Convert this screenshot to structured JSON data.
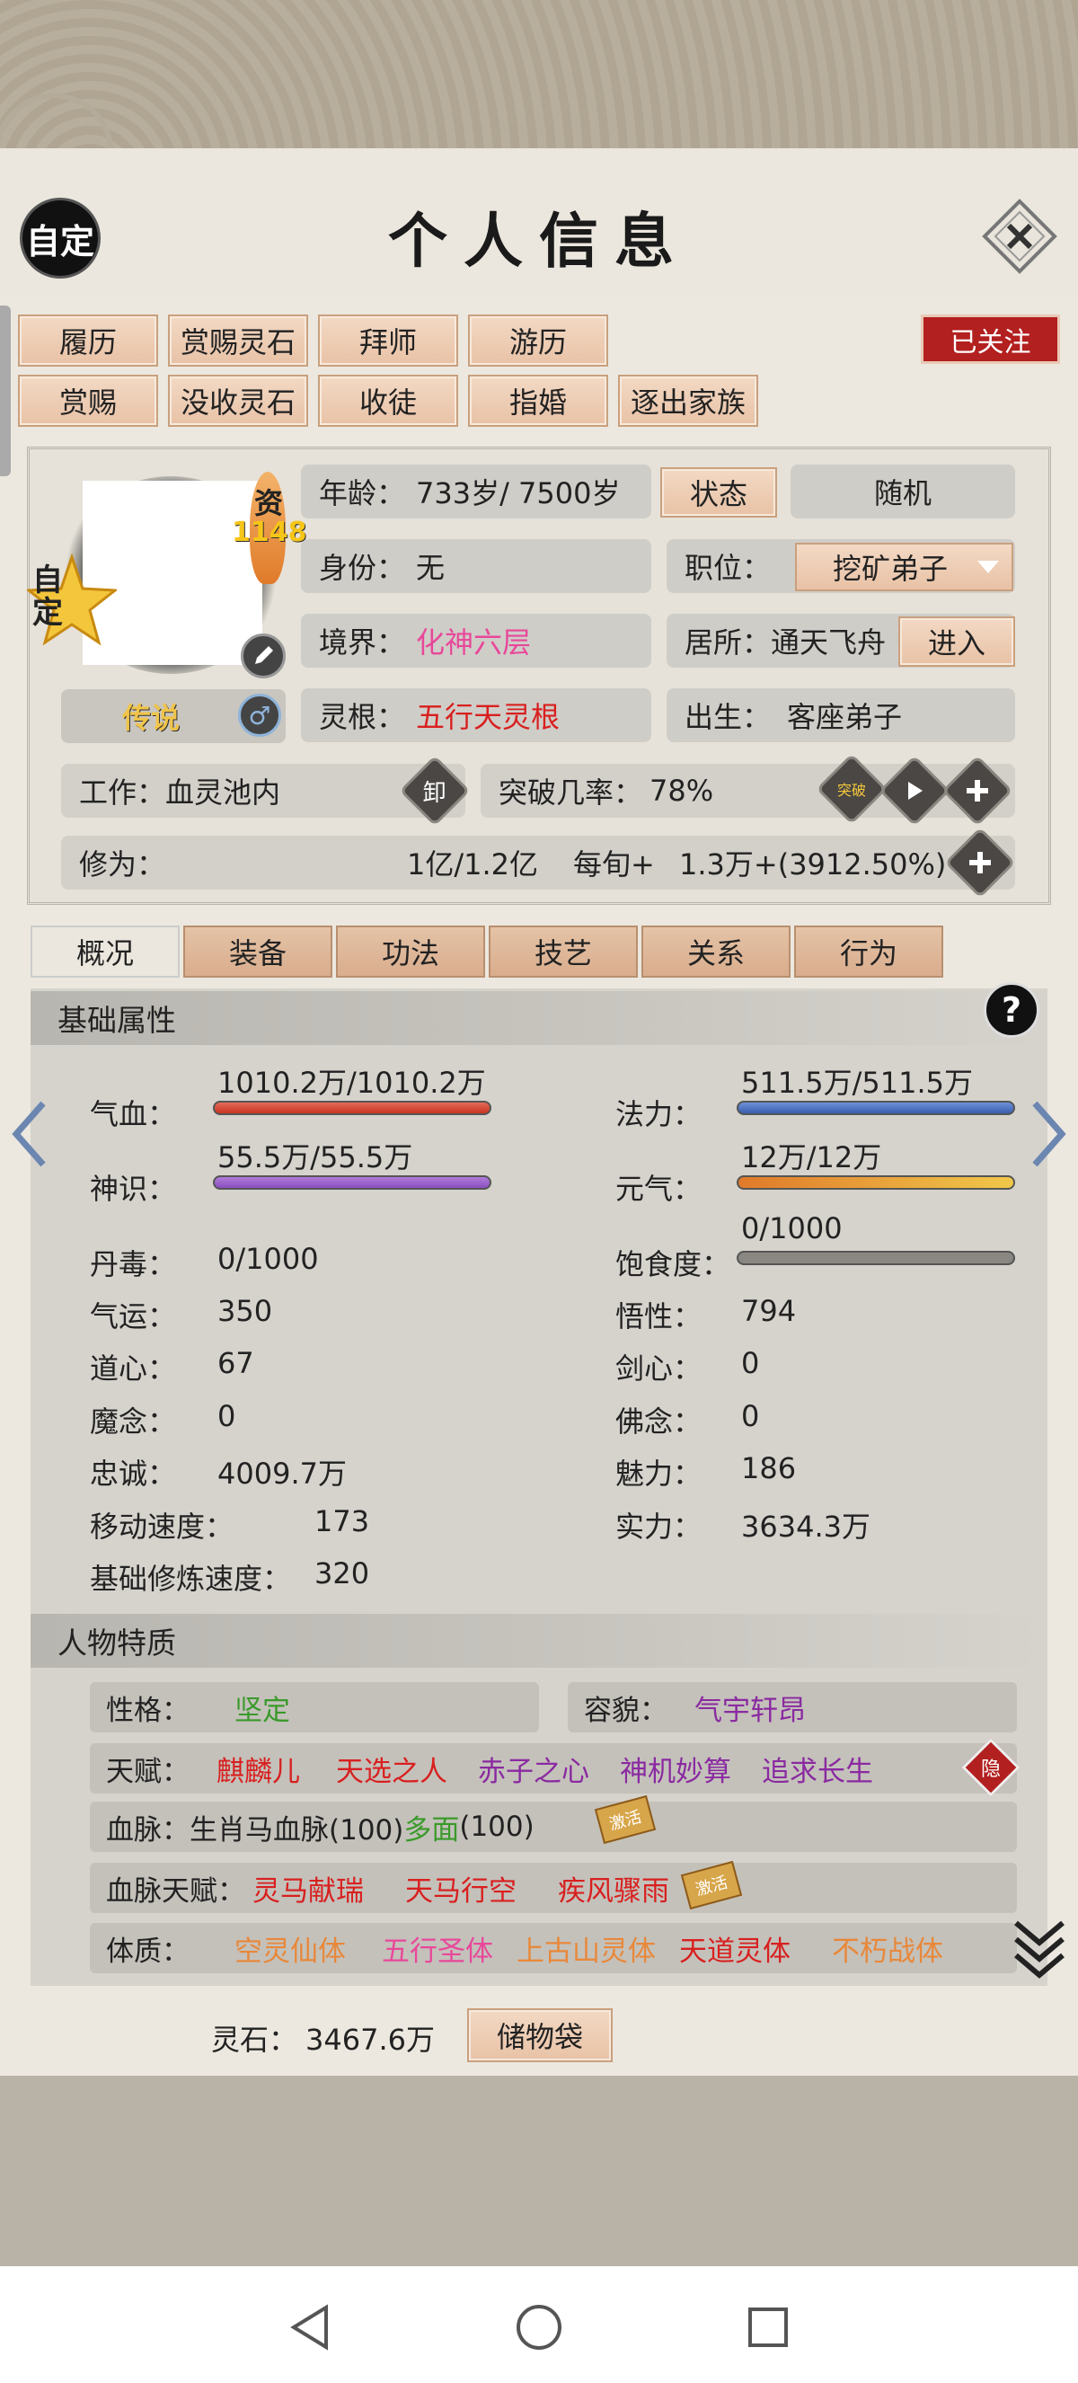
{
  "header": {
    "title": "个人信息",
    "custom_label": "自定"
  },
  "top_buttons_row1": [
    "履历",
    "赏赐灵石",
    "拜师",
    "游历"
  ],
  "top_buttons_row2": [
    "赏赐",
    "没收灵石",
    "收徒",
    "指婚",
    "逐出家族"
  ],
  "followed_label": "已关注",
  "avatar": {
    "zi_label": "资",
    "zi_value": "1148",
    "custom_badge": "自定",
    "rank": "传说"
  },
  "info": {
    "age_label": "年龄：",
    "age_value": "733岁/ 7500岁",
    "status_btn": "状态",
    "random_btn": "随机",
    "identity_label": "身份：",
    "identity_value": "无",
    "position_label": "职位：",
    "position_value": "挖矿弟子",
    "realm_label": "境界：",
    "realm_value": "化神六层",
    "residence_label": "居所：",
    "residence_value": "通天飞舟",
    "enter_btn": "进入",
    "root_label": "灵根：",
    "root_value": "五行天灵根",
    "birth_label": "出生：",
    "birth_value": "客座弟子",
    "work_label": "工作：",
    "work_value": "血灵池内",
    "unload_icon": "卸",
    "breakthrough_label": "突破几率：",
    "breakthrough_value": "78%",
    "breakthrough_icon": "突破",
    "cultivation_label": "修为：",
    "cultivation_value": "1亿/1.2亿",
    "per_label": "每旬+",
    "per_value": "1.3万+(3912.50%)"
  },
  "tabs": [
    "概况",
    "装备",
    "功法",
    "技艺",
    "关系",
    "行为"
  ],
  "basic": {
    "title": "基础属性",
    "hp_label": "气血：",
    "hp_value": "1010.2万/1010.2万",
    "hp_fill": 1.0,
    "mana_label": "法力：",
    "mana_value": "511.5万/511.5万",
    "mana_fill": 1.0,
    "sense_label": "神识：",
    "sense_value": "55.5万/55.5万",
    "sense_fill": 1.0,
    "vital_label": "元气：",
    "vital_value": "12万/12万",
    "vital_fill": 1.0,
    "satiety_label": "饱食度：",
    "satiety_value": "0/1000",
    "satiety_fill": 0,
    "stats_left": [
      {
        "label": "丹毒：",
        "value": "0/1000"
      },
      {
        "label": "气运：",
        "value": "350"
      },
      {
        "label": "道心：",
        "value": "67"
      },
      {
        "label": "魔念：",
        "value": "0"
      },
      {
        "label": "忠诚：",
        "value": "4009.7万"
      },
      {
        "label": "移动速度：",
        "value": "173"
      },
      {
        "label": "基础修炼速度：",
        "value": "320"
      }
    ],
    "stats_right": [
      {
        "label": "悟性：",
        "value": "794"
      },
      {
        "label": "剑心：",
        "value": "0"
      },
      {
        "label": "佛念：",
        "value": "0"
      },
      {
        "label": "魅力：",
        "value": "186"
      },
      {
        "label": "实力：",
        "value": "3634.3万"
      }
    ]
  },
  "traits": {
    "title": "人物特质",
    "personality_label": "性格：",
    "personality_value": "坚定",
    "looks_label": "容貌：",
    "looks_value": "气宇轩昂",
    "talent_label": "天赋：",
    "talents": [
      "麒麟儿",
      "天选之人",
      "赤子之心",
      "神机妙算",
      "追求长生"
    ],
    "hide_icon": "隐",
    "bloodline_label": "血脉：",
    "bloodline_value": "生肖马血脉(100)",
    "bloodline_extra": "多面",
    "bloodline_extra2": "(100)",
    "stamp_label": "激活",
    "blood_talent_label": "血脉天赋：",
    "blood_talents": [
      "灵马献瑞",
      "天马行空",
      "疾风骤雨"
    ],
    "body_label": "体质：",
    "bodies": [
      "空灵仙体",
      "五行圣体",
      "上古山灵体",
      "天道灵体",
      "不朽战体"
    ]
  },
  "footer": {
    "stone_label": "灵石：",
    "stone_value": "3467.6万",
    "storage_btn": "储物袋"
  },
  "colors": {
    "accent_btn": "#e8c2a6",
    "red": "#d8201f",
    "pink": "#e8489a",
    "badge_red": "#b2201f"
  }
}
